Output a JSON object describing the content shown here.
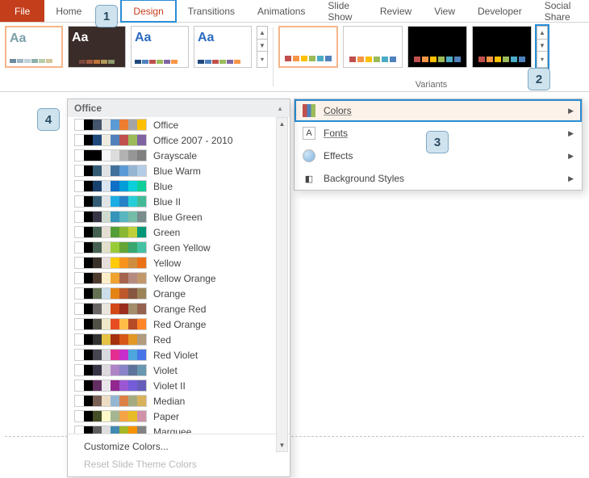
{
  "tabs": {
    "file": "File",
    "home": "Home",
    "design": "Design",
    "transitions": "Transitions",
    "animations": "Animations",
    "slideshow": "Slide Show",
    "review": "Review",
    "view": "View",
    "developer": "Developer",
    "socialshare": "Social Share"
  },
  "ribbon": {
    "variants_label": "Variants",
    "theme_sample": "Aa",
    "theme_colors": [
      [
        "#6e8ca0",
        "#a0b5c4",
        "#c1d1db",
        "#8db0a8",
        "#b7ceaa",
        "#d3c79b"
      ],
      [
        "#3a2c28",
        "#7a473d",
        "#a25b3e",
        "#c07537",
        "#b49a5a",
        "#8c9b6d"
      ],
      [
        "#1f497d",
        "#4f81bd",
        "#c0504d",
        "#9bbb59",
        "#8064a2",
        "#f79646"
      ],
      [
        "#1f497d",
        "#4f81bd",
        "#c0504d",
        "#9bbb59",
        "#8064a2",
        "#f79646"
      ]
    ],
    "variant_bg": [
      "#ffffff",
      "#ffffff",
      "#000000",
      "#000000"
    ],
    "variant_sw": [
      [
        "#c0504d",
        "#f79646",
        "#ffc000",
        "#9bbb59",
        "#4bacc6",
        "#4f81bd"
      ],
      [
        "#c0504d",
        "#f79646",
        "#ffc000",
        "#9bbb59",
        "#4bacc6",
        "#4f81bd"
      ],
      [
        "#c0504d",
        "#f79646",
        "#ffc000",
        "#9bbb59",
        "#4bacc6",
        "#4f81bd"
      ],
      [
        "#c0504d",
        "#f79646",
        "#ffc000",
        "#9bbb59",
        "#4bacc6",
        "#4f81bd"
      ]
    ]
  },
  "colors_dropdown": {
    "header": "Office",
    "customize": "Customize Colors...",
    "reset": "Reset Slide Theme Colors",
    "schemes": [
      {
        "name": "Office",
        "c": [
          "#ffffff",
          "#000000",
          "#44546a",
          "#e7e6e6",
          "#5b9bd5",
          "#ed7d31",
          "#a5a5a5",
          "#ffc000"
        ]
      },
      {
        "name": "Office 2007 - 2010",
        "c": [
          "#ffffff",
          "#000000",
          "#1f497d",
          "#eeece1",
          "#4f81bd",
          "#c0504d",
          "#9bbb59",
          "#8064a2"
        ]
      },
      {
        "name": "Grayscale",
        "c": [
          "#ffffff",
          "#000000",
          "#000000",
          "#f8f8f8",
          "#dddddd",
          "#b2b2b2",
          "#969696",
          "#808080"
        ]
      },
      {
        "name": "Blue Warm",
        "c": [
          "#ffffff",
          "#000000",
          "#335b74",
          "#dfe3e5",
          "#40709c",
          "#5b9bd5",
          "#94b6d2",
          "#b2cde5"
        ]
      },
      {
        "name": "Blue",
        "c": [
          "#ffffff",
          "#000000",
          "#17406d",
          "#dbe5f1",
          "#0f6fc6",
          "#009dd9",
          "#0bd0d9",
          "#10cf9b"
        ]
      },
      {
        "name": "Blue II",
        "c": [
          "#ffffff",
          "#000000",
          "#335b74",
          "#dfe3e5",
          "#1cade4",
          "#2683c6",
          "#27ced7",
          "#42ba97"
        ]
      },
      {
        "name": "Blue Green",
        "c": [
          "#ffffff",
          "#000000",
          "#373545",
          "#cedbce",
          "#3494ba",
          "#58b6c0",
          "#75bda7",
          "#7a8c8e"
        ]
      },
      {
        "name": "Green",
        "c": [
          "#ffffff",
          "#000000",
          "#455f51",
          "#e3ded1",
          "#549e39",
          "#8ab833",
          "#c0cf3a",
          "#029676"
        ]
      },
      {
        "name": "Green Yellow",
        "c": [
          "#ffffff",
          "#000000",
          "#455f51",
          "#e2dfcc",
          "#99cb38",
          "#63a537",
          "#37a76f",
          "#44c1a3"
        ]
      },
      {
        "name": "Yellow",
        "c": [
          "#ffffff",
          "#000000",
          "#39302a",
          "#e5dedb",
          "#ffca08",
          "#f8931d",
          "#ce8d3e",
          "#ec7016"
        ]
      },
      {
        "name": "Yellow Orange",
        "c": [
          "#ffffff",
          "#000000",
          "#4e3b30",
          "#fbeec9",
          "#f0a22e",
          "#a5644e",
          "#b58b80",
          "#c3986d"
        ]
      },
      {
        "name": "Orange",
        "c": [
          "#ffffff",
          "#000000",
          "#637052",
          "#ccddea",
          "#e48312",
          "#bd582c",
          "#865640",
          "#9b8357"
        ]
      },
      {
        "name": "Orange Red",
        "c": [
          "#ffffff",
          "#000000",
          "#696464",
          "#e9e5dc",
          "#d34817",
          "#9b2d1f",
          "#a28e6a",
          "#956251"
        ]
      },
      {
        "name": "Red Orange",
        "c": [
          "#ffffff",
          "#000000",
          "#505046",
          "#eee8c8",
          "#e84c22",
          "#ffbd47",
          "#b64926",
          "#ff8427"
        ]
      },
      {
        "name": "Red",
        "c": [
          "#ffffff",
          "#000000",
          "#323232",
          "#e5c243",
          "#a5300f",
          "#d55816",
          "#e19825",
          "#b19c7d"
        ]
      },
      {
        "name": "Red Violet",
        "c": [
          "#ffffff",
          "#000000",
          "#454551",
          "#d8d9dc",
          "#e32d91",
          "#c830cc",
          "#4ea6dc",
          "#4775e7"
        ]
      },
      {
        "name": "Violet",
        "c": [
          "#ffffff",
          "#000000",
          "#373545",
          "#dcd8dc",
          "#ad84c6",
          "#8784c7",
          "#5d739a",
          "#6997af"
        ]
      },
      {
        "name": "Violet II",
        "c": [
          "#ffffff",
          "#000000",
          "#632e62",
          "#eae5eb",
          "#92278f",
          "#9b57d3",
          "#755dd9",
          "#665eb8"
        ]
      },
      {
        "name": "Median",
        "c": [
          "#ffffff",
          "#000000",
          "#775f55",
          "#ebddc3",
          "#94b6d2",
          "#dd8047",
          "#a5ab81",
          "#d8b25c"
        ]
      },
      {
        "name": "Paper",
        "c": [
          "#ffffff",
          "#000000",
          "#444d26",
          "#fefac9",
          "#a5b592",
          "#f3a447",
          "#e7bc29",
          "#d092a7"
        ]
      },
      {
        "name": "Marquee",
        "c": [
          "#ffffff",
          "#000000",
          "#5e5e5e",
          "#dddddd",
          "#418ab3",
          "#a6b727",
          "#f69200",
          "#838383"
        ]
      }
    ]
  },
  "variants_menu": {
    "colors": "Colors",
    "fonts": "Fonts",
    "effects": "Effects",
    "bg": "Background Styles"
  },
  "badges": {
    "b1": "1",
    "b2": "2",
    "b3": "3",
    "b4": "4"
  }
}
